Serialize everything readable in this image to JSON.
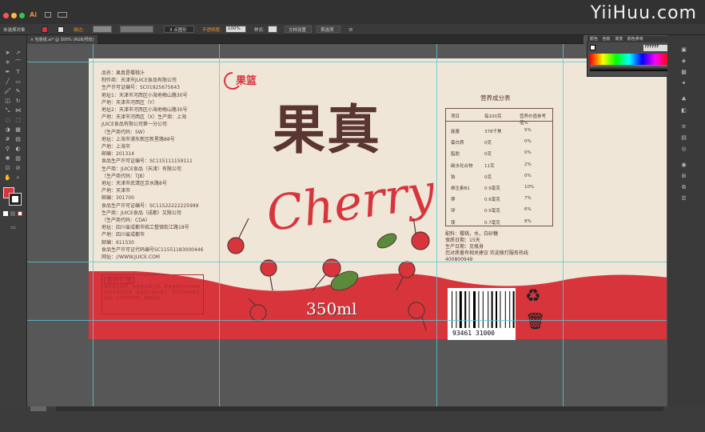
{
  "app": {
    "logo": "Ai",
    "watermark": "YiiHuu.com"
  },
  "control": {
    "selection": "未选择对象",
    "stroke_label": "描边:",
    "brush": "3 点圆形",
    "opacity_label": "不透明度:",
    "opacity": "100%",
    "style_label": "样式:",
    "doc_setup": "文档设置",
    "prefs": "首选项"
  },
  "doc_tab": "包裝纸.ai* @ 300% (RGB/预览)",
  "right_tabs": [
    "颜色",
    "色板",
    "渐变",
    "颜色参考"
  ],
  "hex": "FFFFFF",
  "label": {
    "side_text": "品名：果真是樱桃汁\n制作商：天津市JUICE食品有限公司\n生产许可证编号：SC01925675643\n地址1：天津市河西区小海地梅山路30号\n产地：天津市河西区（Y）\n地址2：天津市河西区小海地梅山路30号\n产地：天津市河西区（X）生产商：上海\nJUICE食品有限公司第一分公司\n（生产商代码：SW）\n地址：上海市浦东新区新星路88号\n产地：上海市\n邮编：201314\n食品生产许可证编号：SC115111159111\n生产商：JUICE食品（天津）有限公司\n（生产商代码：TJB）\n地址：天津市武清区京水路8号\n产地：天津市\n邮编：301700\n食品生产许可证编号：SC11522222225999\n生产商：JUICE食品（成都）又限公司\n（生产商代码：CDA）\n地址：四川省成都市临工整镇街江路18号\n产地：四川省成都市\n邮编：611530\n食品生产许可证代码编号SC11551183000446\n网址：//WWW.JUICE.COM",
    "brand": "果篮",
    "title": "果真",
    "cherry": "Cherry",
    "volume": "350ml",
    "nutrition_title": "营养成分表",
    "nutrition_header": [
      "项目",
      "每100克",
      "营养价值参考值%"
    ],
    "nutrition_rows": [
      [
        "能量",
        "378千焦",
        "5%"
      ],
      [
        "蛋白质",
        "0克",
        "0%"
      ],
      [
        "脂肪",
        "0克",
        "0%"
      ],
      [
        "碳水化合物",
        "11克",
        "2%"
      ],
      [
        "钠",
        "0克",
        "0%"
      ],
      [
        "维生素B1",
        "0.9毫克",
        "10%"
      ],
      [
        "钾",
        "0.6毫克",
        "7%"
      ],
      [
        "锌",
        "0.5毫克",
        "6%"
      ],
      [
        "镁",
        "0.7毫克",
        "8%"
      ]
    ],
    "ingredients": "配料：樱桃，水，白砂糖\n保质日期：15天\n生产日期：见瓶身\n您对质量有相关建议 欢迎拨打服务热线\n400800949",
    "barcode_number": "93461 31000",
    "nutri_box_title": "营养价值",
    "nutri_box_text": "樱桃富含铁质，含量居水果之首，常食樱桃可补充体内对铁元素的需求，促进血红蛋白再生，既可防治缺铁性贫血，又可增强体质，健脑益智。"
  },
  "colors": {
    "red": "#d8343c",
    "brown": "#5a3531",
    "cream": "#efe6d8"
  }
}
